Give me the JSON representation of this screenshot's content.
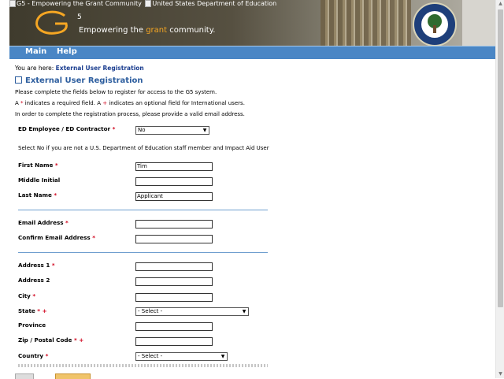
{
  "header": {
    "logo_alt": "G5 - Empowering the Grant Community",
    "dept_alt": "United States Department of Education",
    "tagline_pre": "Empowering the ",
    "tagline_accent": "grant",
    "tagline_post": " community.",
    "logo_superscript": "5"
  },
  "nav": {
    "items": [
      "Main",
      "Help"
    ]
  },
  "breadcrumb": {
    "prefix": "You are here: ",
    "current": "External User Registration"
  },
  "page_title": "External User Registration",
  "intro": {
    "line1": "Please complete the fields below to register for access to the G5 system.",
    "line2_a": "A ",
    "line2_star": "*",
    "line2_b": " indicates a required field. A ",
    "line2_plus": "+",
    "line2_c": " indicates an optional field for International users.",
    "line3": "In order to complete the registration process, please provide a valid email address."
  },
  "form": {
    "ed_employee": {
      "label": "ED Employee / ED Contractor",
      "value": "No"
    },
    "ed_hint": "Select No if you are not a U.S. Department of Education staff member and Impact Aid User",
    "first_name": {
      "label": "First Name",
      "value": "Tim"
    },
    "middle_initial": {
      "label": "Middle Initial",
      "value": ""
    },
    "last_name": {
      "label": "Last Name",
      "value": "Applicant"
    },
    "email": {
      "label": "Email Address",
      "value": ""
    },
    "confirm_email": {
      "label": "Confirm Email Address",
      "value": ""
    },
    "address1": {
      "label": "Address 1",
      "value": ""
    },
    "address2": {
      "label": "Address 2",
      "value": ""
    },
    "city": {
      "label": "City",
      "value": ""
    },
    "state": {
      "label": "State",
      "value": "- Select -"
    },
    "province": {
      "label": "Province",
      "value": ""
    },
    "zip": {
      "label": "Zip / Postal Code",
      "value": ""
    },
    "country": {
      "label": "Country",
      "value": "- Select -"
    },
    "required_mark": "*",
    "intl_mark": "+"
  },
  "colors": {
    "nav_bar": "#4a86c5",
    "heading": "#2c5d9e",
    "required": "#d0021b",
    "divider": "#6f9fcf"
  }
}
